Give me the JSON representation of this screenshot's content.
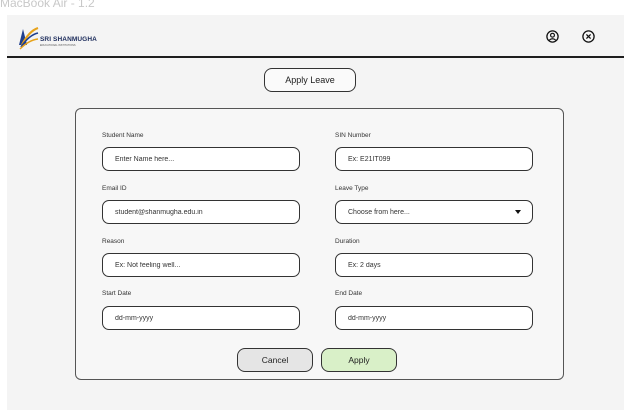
{
  "frame_label": "MacBook Air - 1.2",
  "header": {
    "brand_name": "SRI SHANMUGHA",
    "brand_tagline": "EDUCATIONAL INSTITUTIONS",
    "icons": [
      "profile-icon",
      "close-icon"
    ]
  },
  "page_title": "Apply Leave",
  "form": {
    "student_name": {
      "label": "Student Name",
      "placeholder": "Enter Name here..."
    },
    "sin_number": {
      "label": "SIN Number",
      "placeholder": "Ex: E21IT099"
    },
    "email": {
      "label": "Email ID",
      "value": "student@shanmugha.edu.in"
    },
    "leave_type": {
      "label": "Leave Type",
      "selected": "Choose from here..."
    },
    "reason": {
      "label": "Reason",
      "placeholder": "Ex: Not feeling well..."
    },
    "duration": {
      "label": "Duration",
      "placeholder": "Ex: 2 days"
    },
    "start_date": {
      "label": "Start Date",
      "placeholder": "dd-mm-yyyy"
    },
    "end_date": {
      "label": "End Date",
      "placeholder": "dd-mm-yyyy"
    }
  },
  "buttons": {
    "cancel": "Cancel",
    "apply": "Apply"
  },
  "colors": {
    "apply_button": "#d9f0c8",
    "cancel_button": "#e5e5e5",
    "background": "#f4f4f4"
  }
}
